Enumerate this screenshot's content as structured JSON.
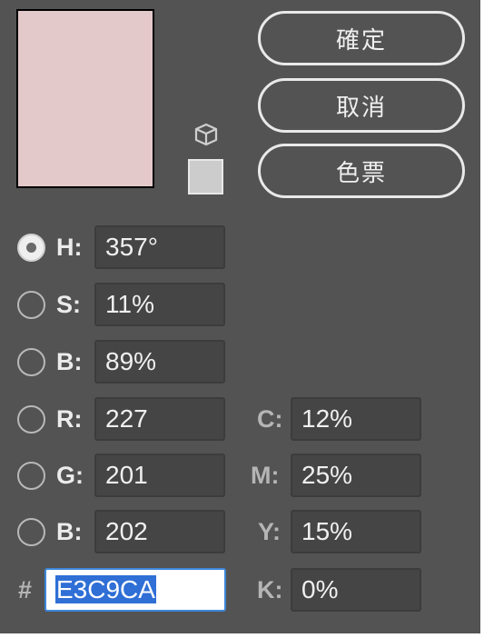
{
  "preview": {
    "current_color": "#e3c9ca"
  },
  "gamut_swatch_color": "#cccccc",
  "buttons": {
    "ok": "確定",
    "cancel": "取消",
    "swatches": "色票"
  },
  "hsb": [
    {
      "key": "h",
      "label": "H:",
      "value": "357°",
      "selected": true
    },
    {
      "key": "s",
      "label": "S:",
      "value": "11%",
      "selected": false
    },
    {
      "key": "b",
      "label": "B:",
      "value": "89%",
      "selected": false
    }
  ],
  "rgb": [
    {
      "key": "r",
      "label": "R:",
      "value": "227",
      "selected": false
    },
    {
      "key": "g",
      "label": "G:",
      "value": "201",
      "selected": false
    },
    {
      "key": "b",
      "label": "B:",
      "value": "202",
      "selected": false
    }
  ],
  "cmyk": [
    {
      "key": "c",
      "label": "C:",
      "value": "12%"
    },
    {
      "key": "m",
      "label": "M:",
      "value": "25%"
    },
    {
      "key": "y",
      "label": "Y:",
      "value": "15%"
    },
    {
      "key": "k",
      "label": "K:",
      "value": "0%"
    }
  ],
  "hex": {
    "label": "#",
    "value": "E3C9CA"
  },
  "colors": {
    "panel": "#535353",
    "field": "#454545",
    "selection": "#2f6fd6"
  }
}
